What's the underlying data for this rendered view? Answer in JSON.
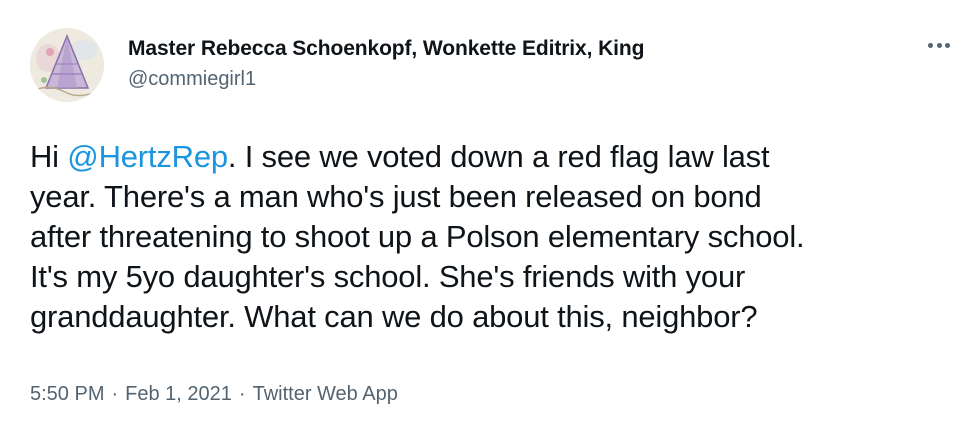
{
  "author": {
    "display_name": "Master Rebecca Schoenkopf, Wonkette Editrix, King",
    "handle": "@commiegirl1",
    "avatar_icon": "child-drawing-avatar"
  },
  "more_menu": {
    "icon": "more-horizontal-icon"
  },
  "tweet": {
    "line1": {
      "pre": "Hi ",
      "mention": "@HertzRep",
      "post": ". I see we voted down a red flag law last"
    },
    "line2": "year. There's a man who's just been released on bond",
    "line3": "after threatening to shoot up a Polson elementary school.",
    "line4": "It's my 5yo daughter's school. She's friends with your",
    "line5": "granddaughter. What can we do about this, neighbor?"
  },
  "meta": {
    "time": "5:50 PM",
    "separator": "·",
    "date": "Feb 1, 2021",
    "app": "Twitter Web App"
  },
  "colors": {
    "text": "#0f1419",
    "secondary": "#536471",
    "link": "#1b95e0"
  }
}
